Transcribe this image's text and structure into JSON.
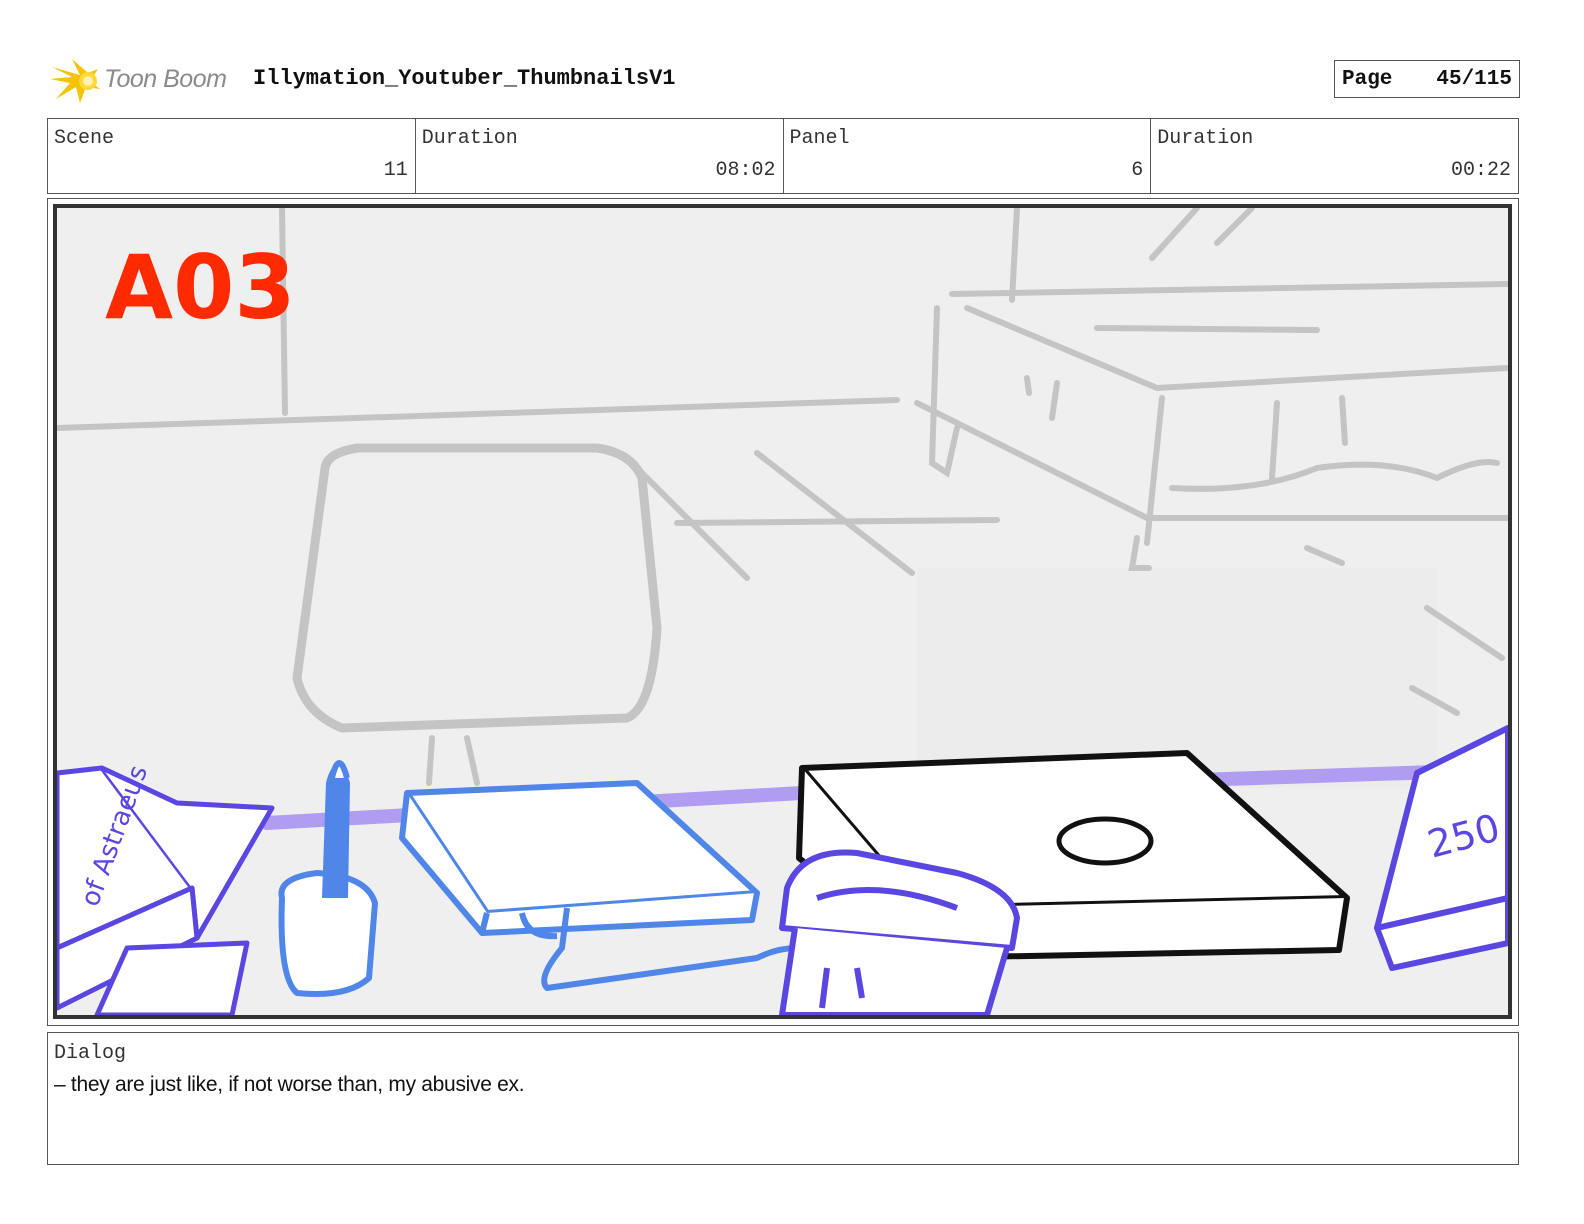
{
  "header": {
    "logo_text": "Toon Boom",
    "project_title": "Illymation_Youtuber_ThumbnailsV1",
    "page_label": "Page",
    "page_number": "45/115"
  },
  "info": {
    "scene_label": "Scene",
    "scene_value": "11",
    "scene_duration_label": "Duration",
    "scene_duration_value": "08:02",
    "panel_label": "Panel",
    "panel_value": "6",
    "panel_duration_label": "Duration",
    "panel_duration_value": "00:22"
  },
  "panel": {
    "sketch_label": "A03",
    "book_left_text": "of Astraeus",
    "book_right_text": "250"
  },
  "dialog": {
    "label": "Dialog",
    "text": "– they are just like, if not worse than, my abusive ex."
  },
  "colors": {
    "sketch_red": "#ff2a00",
    "sketch_blue": "#4f86e8",
    "sketch_violet": "#5a46e0",
    "sketch_grey": "#c4c4c4",
    "logo_yellow": "#f5c400"
  }
}
